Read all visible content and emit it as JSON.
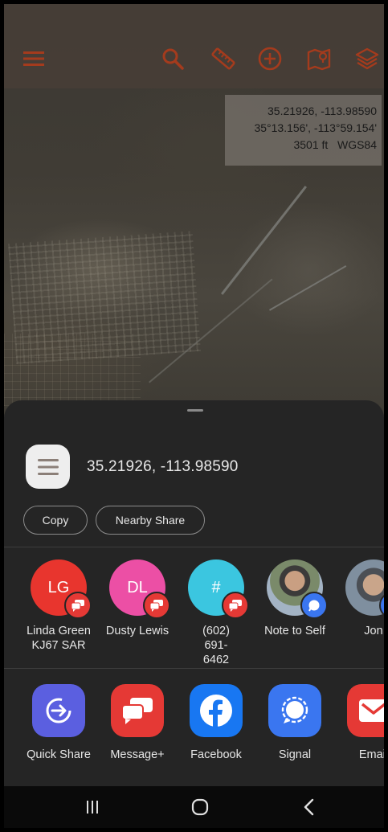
{
  "map": {
    "coords": {
      "decimal": "35.21926, -113.98590",
      "dms": "35°13.156', -113°59.154'",
      "elevation": "3501 ft",
      "datum": "WGS84"
    },
    "toolbar_icons": [
      "menu-icon",
      "search-icon",
      "ruler-icon",
      "add-icon",
      "map-pin-icon",
      "layers-icon"
    ]
  },
  "share": {
    "content_text": "35.21926, -113.98590",
    "actions": [
      {
        "id": "copy",
        "label": "Copy"
      },
      {
        "id": "nearby",
        "label": "Nearby Share"
      }
    ],
    "contacts": [
      {
        "initials": "LG",
        "name": "Linda Green KJ67 SAR",
        "color": "#e8352e",
        "badge": "message-plus",
        "badge_color": "#e53935"
      },
      {
        "initials": "DL",
        "name": "Dusty Lewis",
        "color": "#ec4fa5",
        "badge": "message-plus",
        "badge_color": "#e53935"
      },
      {
        "initials": "#",
        "name": "(602) 691-6462",
        "color": "#3bc6e0",
        "badge": "message-plus",
        "badge_color": "#e53935"
      },
      {
        "initials": "",
        "name": "Note to Self",
        "color": "#6d7b88",
        "badge": "signal",
        "badge_color": "#3a76f0"
      },
      {
        "initials": "",
        "name": "Jon",
        "color": "#8a7c6a",
        "badge": "signal",
        "badge_color": "#3a76f0"
      }
    ],
    "apps": [
      {
        "id": "quick-share",
        "label": "Quick Share",
        "color": "#5b5fe0"
      },
      {
        "id": "message-plus",
        "label": "Message+",
        "color": "#e53935"
      },
      {
        "id": "facebook",
        "label": "Facebook",
        "color": "#1877f2"
      },
      {
        "id": "signal",
        "label": "Signal",
        "color": "#3a76f0"
      },
      {
        "id": "email",
        "label": "Email",
        "color": "#e53935"
      }
    ]
  },
  "nav": [
    "recent-apps-icon",
    "home-icon",
    "back-icon"
  ]
}
